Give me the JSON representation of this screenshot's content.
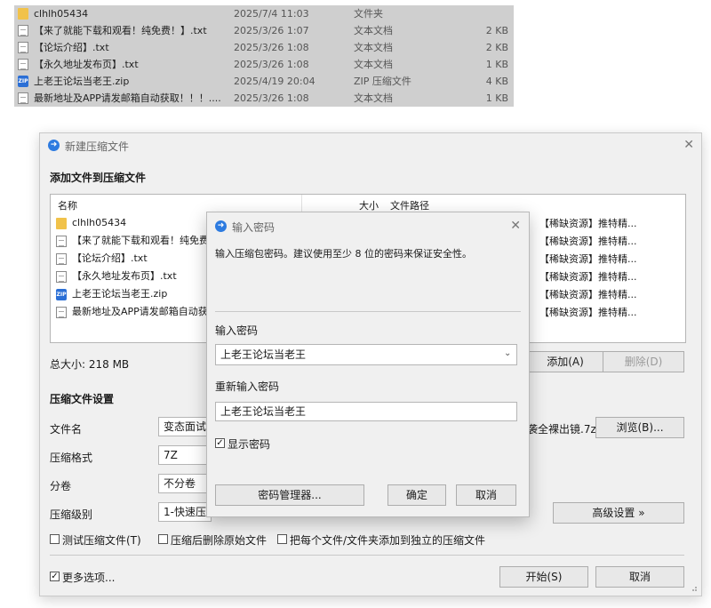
{
  "explorer": {
    "files": [
      {
        "name": "clhlh05434",
        "date": "2025/7/4 11:03",
        "type": "文件夹",
        "size": "",
        "icon": "folder-icon"
      },
      {
        "name": "【来了就能下载和观看！纯免费！】.txt",
        "date": "2025/3/26 1:07",
        "type": "文本文档",
        "size": "2 KB",
        "icon": "text-file-icon"
      },
      {
        "name": "【论坛介绍】.txt",
        "date": "2025/3/26 1:08",
        "type": "文本文档",
        "size": "2 KB",
        "icon": "text-file-icon"
      },
      {
        "name": "【永久地址发布页】.txt",
        "date": "2025/3/26 1:08",
        "type": "文本文档",
        "size": "1 KB",
        "icon": "text-file-icon"
      },
      {
        "name": "上老王论坛当老王.zip",
        "date": "2025/4/19 20:04",
        "type": "ZIP 压缩文件",
        "size": "4 KB",
        "icon": "zip-file-icon"
      },
      {
        "name": "最新地址及APP请发邮箱自动获取！！！....",
        "date": "2025/3/26 1:08",
        "type": "文本文档",
        "size": "1 KB",
        "icon": "text-file-icon"
      }
    ]
  },
  "main_dialog": {
    "title": "新建压缩文件",
    "add_section": "添加文件到压缩文件",
    "columns": {
      "name": "名称",
      "size": "大小",
      "path": "文件路径"
    },
    "items": [
      {
        "name": "clhlh05434",
        "path": "【稀缺资源】推特精...",
        "icon": "folder-icon"
      },
      {
        "name": "【来了就能下载和观看！纯免费",
        "path": "【稀缺资源】推特精...",
        "icon": "text-file-icon"
      },
      {
        "name": "【论坛介绍】.txt",
        "path": "【稀缺资源】推特精...",
        "icon": "text-file-icon"
      },
      {
        "name": "【永久地址发布页】.txt",
        "path": "【稀缺资源】推特精...",
        "icon": "text-file-icon"
      },
      {
        "name": "上老王论坛当老王.zip",
        "path": "【稀缺资源】推特精...",
        "icon": "zip-file-icon"
      },
      {
        "name": "最新地址及APP请发邮箱自动获",
        "path": "【稀缺资源】推特精...",
        "icon": "text-file-icon"
      }
    ],
    "total_size": "总大小: 218 MB",
    "add_btn": "添加(A)",
    "delete_btn": "删除(D)",
    "settings_title": "压缩文件设置",
    "filename_label": "文件名",
    "filename_value": "变态面试官",
    "filename_tail": "袭全裸出镜.7z",
    "browse_btn": "浏览(B)...",
    "format_label": "压缩格式",
    "format_value": "7Z",
    "split_label": "分卷",
    "split_value": "不分卷",
    "level_label": "压缩级别",
    "level_value": "1-快速压缩",
    "advanced_btn": "高级设置 »",
    "opt_test": "测试压缩文件(T)",
    "opt_delete": "压缩后删除原始文件",
    "opt_separate": "把每个文件/文件夹添加到独立的压缩文件",
    "more_options": "更多选项...",
    "start_btn": "开始(S)",
    "cancel_btn": "取消"
  },
  "password_dialog": {
    "title": "输入密码",
    "description": "输入压缩包密码。建议使用至少 8 位的密码来保证安全性。",
    "enter_label": "输入密码",
    "password_value": "上老王论坛当老王",
    "reenter_label": "重新输入密码",
    "repeat_value": "上老王论坛当老王",
    "show_password": "显示密码",
    "manager_btn": "密码管理器...",
    "ok_btn": "确定",
    "cancel_btn": "取消"
  }
}
